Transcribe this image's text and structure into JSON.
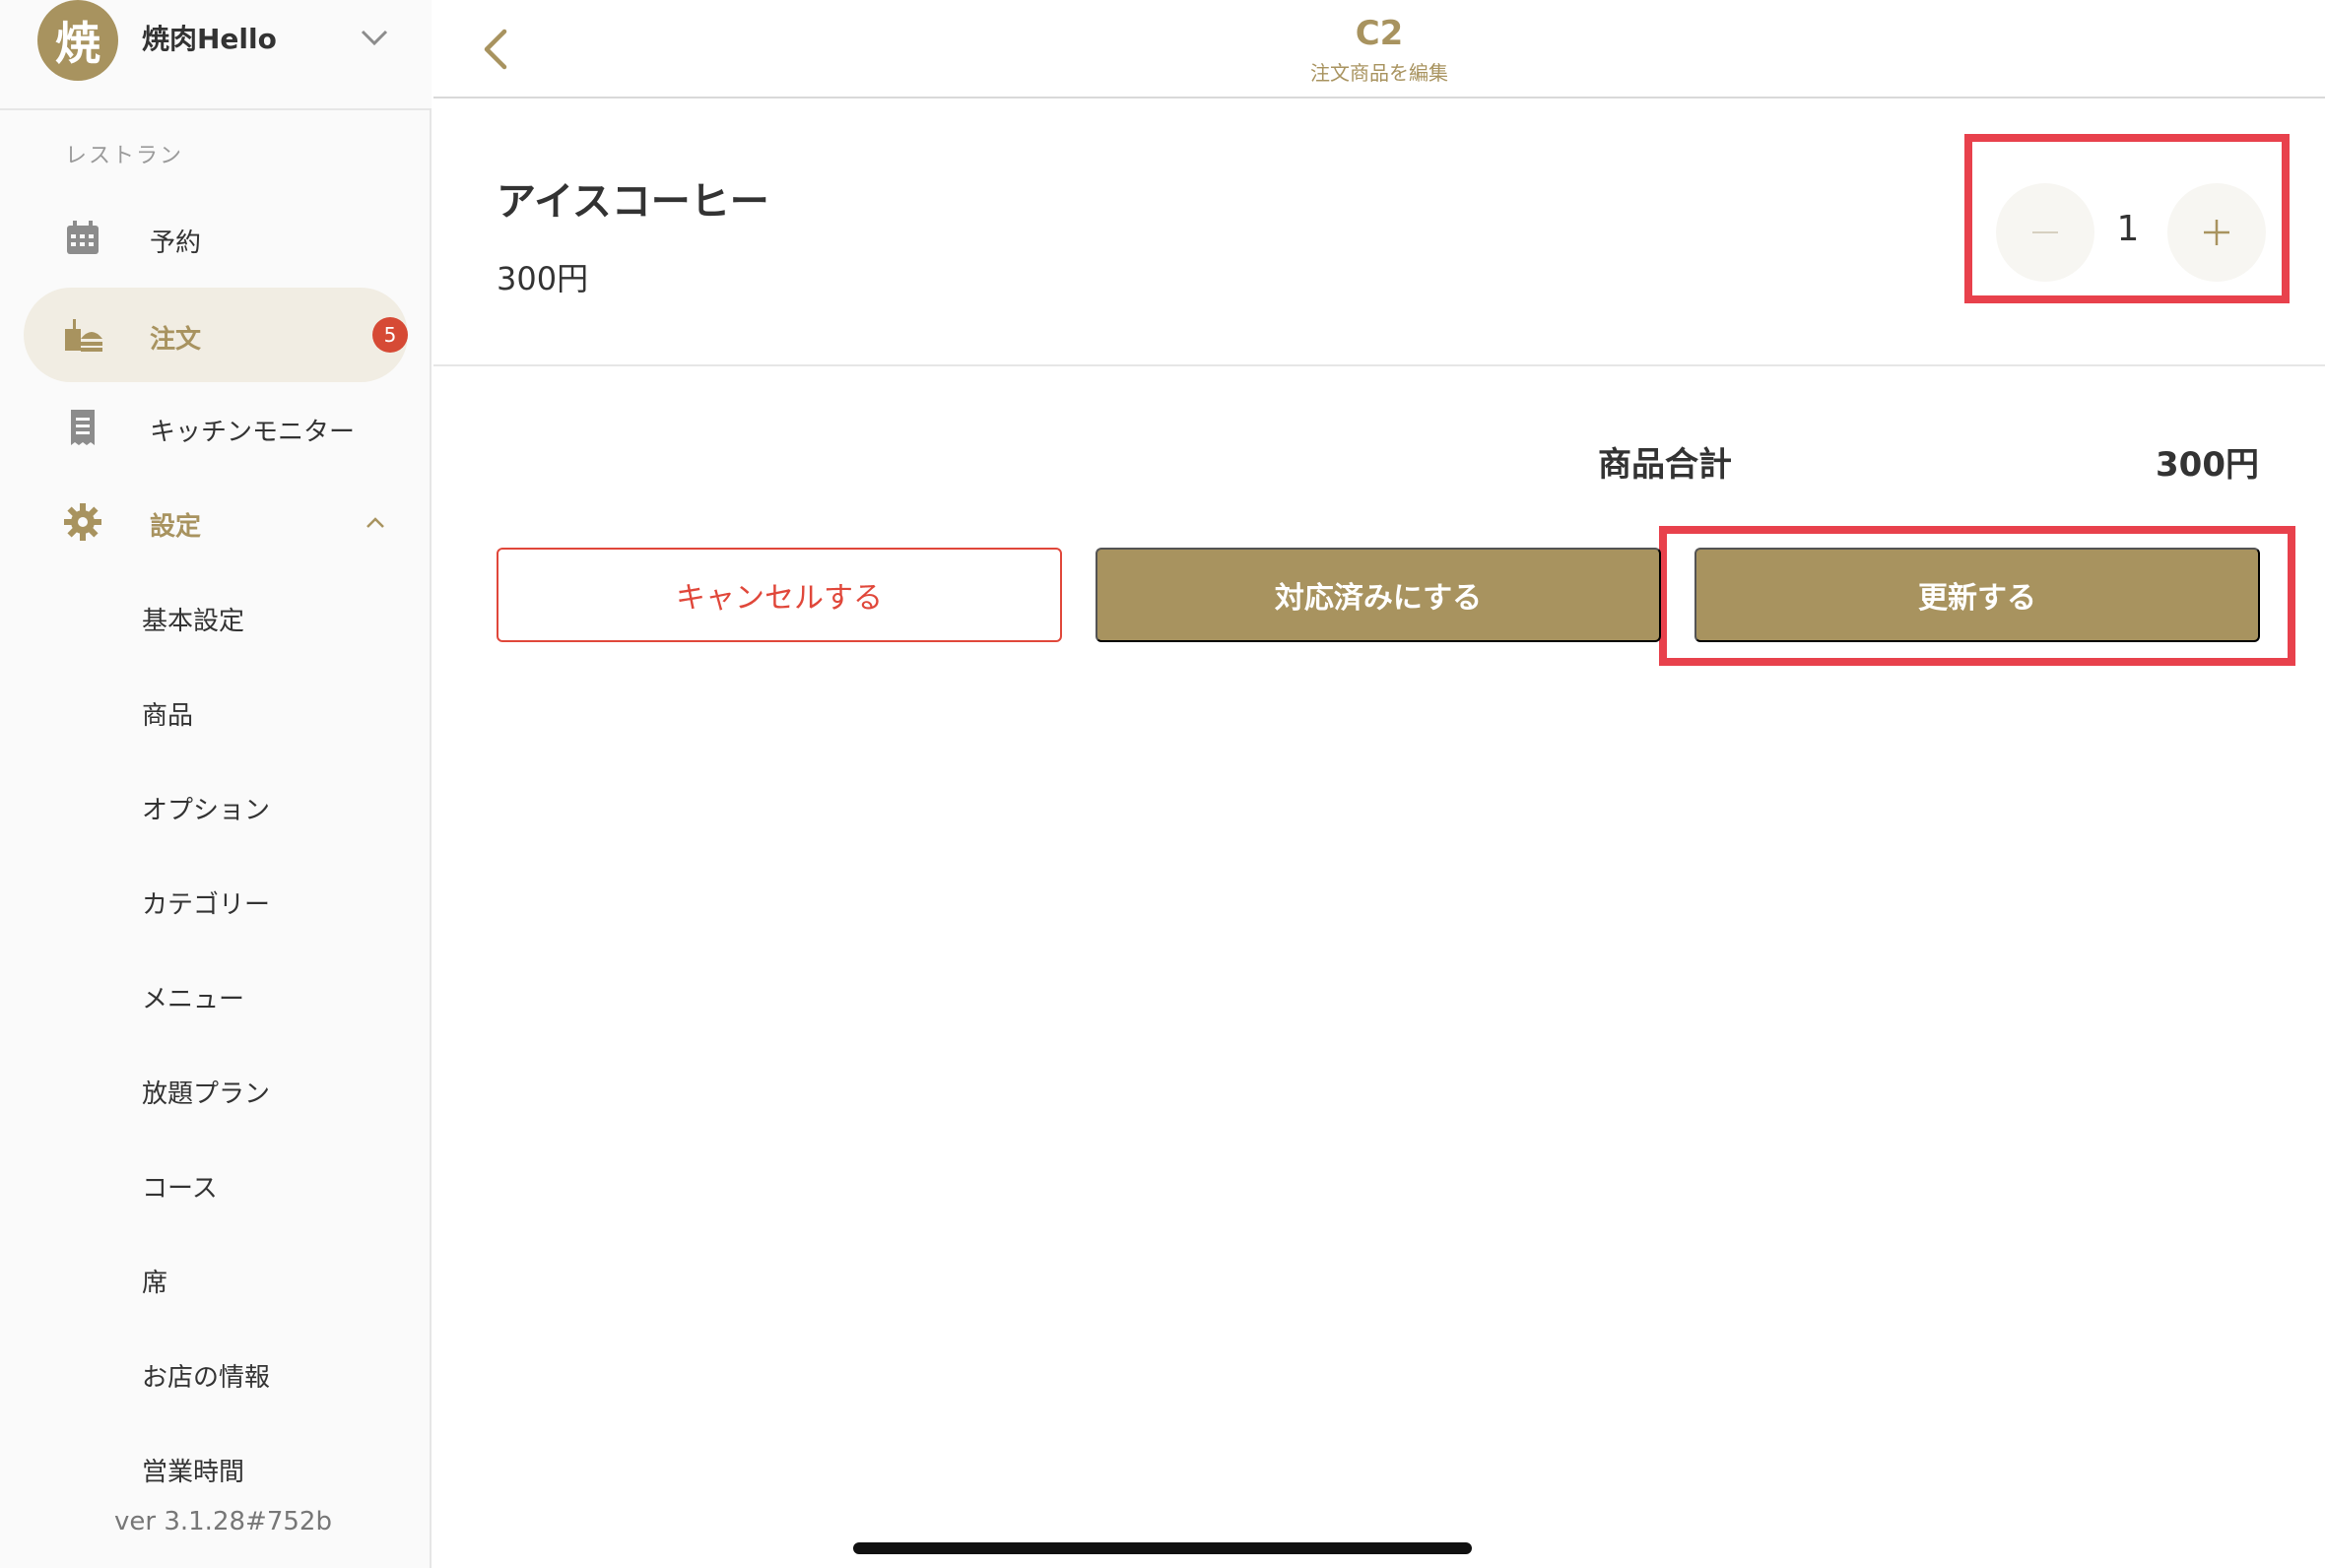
{
  "sidebar": {
    "store": {
      "avatar_text": "焼",
      "name": "焼肉Hello"
    },
    "section_label": "レストラン",
    "items": [
      {
        "label": "予約",
        "icon": "calendar-icon"
      },
      {
        "label": "注文",
        "icon": "food-order-icon",
        "badge": "5",
        "active": true
      },
      {
        "label": "キッチンモニター",
        "icon": "receipt-icon"
      },
      {
        "label": "設定",
        "icon": "gear-icon",
        "expanded": true
      }
    ],
    "settings_sub_items": [
      "基本設定",
      "商品",
      "オプション",
      "カテゴリー",
      "メニュー",
      "放題プラン",
      "コース",
      "席",
      "お店の情報",
      "営業時間"
    ],
    "version": "ver 3.1.28#752b"
  },
  "header": {
    "title": "C2",
    "subtitle": "注文商品を編集"
  },
  "item": {
    "name": "アイスコーヒー",
    "price": "300円",
    "quantity": "1"
  },
  "summary": {
    "label": "商品合計",
    "value": "300円"
  },
  "actions": {
    "cancel_label": "キャンセルする",
    "done_label": "対応済みにする",
    "update_label": "更新する"
  },
  "colors": {
    "accent": "#a8935f",
    "danger": "#e0473a",
    "highlight": "#e8414c",
    "badge": "#d64a35"
  }
}
